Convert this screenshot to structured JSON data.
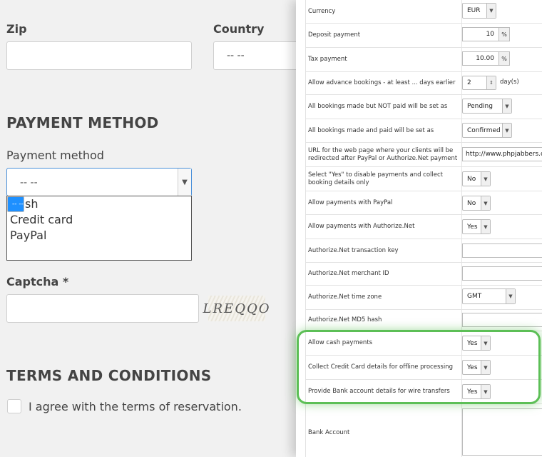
{
  "form": {
    "zip_label": "Zip",
    "country_label": "Country",
    "country_value": "-- --",
    "payment_section": "PAYMENT METHOD",
    "payment_label": "Payment method",
    "payment_value": "-- --",
    "payment_options": [
      "-- --",
      "Cash",
      "Credit card",
      "PayPal"
    ],
    "captcha_label": "Captcha *",
    "captcha_image_text": "LREQQO",
    "terms_section": "TERMS AND CONDITIONS",
    "agree_text": "I agree with the terms of reservation."
  },
  "settings": {
    "rows": [
      {
        "label": "Currency",
        "value": "EUR"
      },
      {
        "label": "Deposit payment",
        "value": "10",
        "unit": "%"
      },
      {
        "label": "Tax payment",
        "value": "10.00",
        "unit": "%"
      },
      {
        "label": "Allow advance bookings - at least ... days earlier",
        "value": "2",
        "unit": "day(s)"
      },
      {
        "label": "All bookings made but NOT paid will be set as",
        "value": "Pending"
      },
      {
        "label": "All bookings made and paid will be set as",
        "value": "Confirmed"
      },
      {
        "label": "URL for the web page where your clients will be redirected after PayPal or Authorize.Net payment",
        "value": "http://www.phpjabbers.c"
      },
      {
        "label": "Select \"Yes\" to disable payments and collect booking details only",
        "value": "No"
      },
      {
        "label": "Allow payments with PayPal",
        "value": "No"
      },
      {
        "label": "Allow payments with Authorize.Net",
        "value": "Yes"
      },
      {
        "label": "Authorize.Net transaction key",
        "value": ""
      },
      {
        "label": "Authorize.Net merchant ID",
        "value": ""
      },
      {
        "label": "Authorize.Net time zone",
        "value": "GMT"
      },
      {
        "label": "Authorize.Net MD5 hash",
        "value": ""
      },
      {
        "label": "Allow cash payments",
        "value": "Yes"
      },
      {
        "label": "Collect Credit Card details for offline processing",
        "value": "Yes"
      },
      {
        "label": "Provide Bank account details for wire transfers",
        "value": "Yes"
      },
      {
        "label": "Bank Account",
        "value": ""
      }
    ]
  },
  "colors": {
    "highlight": "#5cbf56",
    "selected_option": "#1e90ff"
  }
}
